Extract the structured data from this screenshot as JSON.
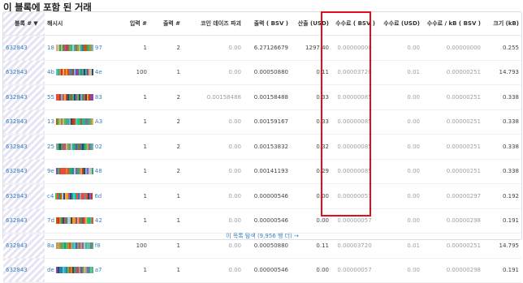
{
  "title": "이 블록에 포함 된 거래",
  "columns": {
    "block": "블록 #",
    "hash": "해시시",
    "inputs": "입력 #",
    "outputs": "출력 #",
    "coindays": "코인 데이즈 파괴",
    "output": "출력 ( BSV )",
    "output_usd": "산출 (USD)",
    "fee": "수수료 ( BSV )",
    "fee_usd": "수수료 (USD)",
    "fee_kb": "수수료 / kB ( BSV )",
    "size": "크기 (kB)"
  },
  "sort_indicator": "▼",
  "rows": [
    {
      "block": "632843",
      "hash_start": "18",
      "hash_end": "97",
      "inputs": "1",
      "outputs": "2",
      "coindays": "0.00",
      "output": "6.27126679",
      "output_usd": "1297.40",
      "fee": "0.00000000",
      "fee_usd": "0.00",
      "fee_kb": "0.00000000",
      "size": "0.255"
    },
    {
      "block": "632843",
      "hash_start": "4b",
      "hash_end": "4e",
      "inputs": "100",
      "outputs": "1",
      "coindays": "0.00",
      "output": "0.00050880",
      "output_usd": "0.11",
      "fee": "0.00003720",
      "fee_usd": "0.01",
      "fee_kb": "0.00000251",
      "size": "14.793"
    },
    {
      "block": "632843",
      "hash_start": "55",
      "hash_end": "83",
      "inputs": "1",
      "outputs": "2",
      "coindays": "0.00158488",
      "output": "0.00158488",
      "output_usd": "0.33",
      "fee": "0.00000085",
      "fee_usd": "0.00",
      "fee_kb": "0.00000251",
      "size": "0.338"
    },
    {
      "block": "632843",
      "hash_start": "13",
      "hash_end": "A3",
      "inputs": "1",
      "outputs": "2",
      "coindays": "0.00",
      "output": "0.00159167",
      "output_usd": "0.33",
      "fee": "0.00000085",
      "fee_usd": "0.00",
      "fee_kb": "0.00000251",
      "size": "0.338"
    },
    {
      "block": "632843",
      "hash_start": "25",
      "hash_end": "02",
      "inputs": "1",
      "outputs": "2",
      "coindays": "0.00",
      "output": "0.00153832",
      "output_usd": "0.32",
      "fee": "0.00000085",
      "fee_usd": "0.00",
      "fee_kb": "0.00000251",
      "size": "0.338"
    },
    {
      "block": "632843",
      "hash_start": "9e",
      "hash_end": "48",
      "inputs": "1",
      "outputs": "2",
      "coindays": "0.00",
      "output": "0.00141193",
      "output_usd": "0.29",
      "fee": "0.00000085",
      "fee_usd": "0.00",
      "fee_kb": "0.00000251",
      "size": "0.338"
    },
    {
      "block": "632843",
      "hash_start": "c4",
      "hash_end": "6d",
      "inputs": "1",
      "outputs": "1",
      "coindays": "0.00",
      "output": "0.00000546",
      "output_usd": "0.00",
      "fee": "0.00000057",
      "fee_usd": "0.00",
      "fee_kb": "0.00000297",
      "size": "0.192"
    },
    {
      "block": "632843",
      "hash_start": "7d",
      "hash_end": "42",
      "inputs": "1",
      "outputs": "1",
      "coindays": "0.00",
      "output": "0.00000546",
      "output_usd": "0.00",
      "fee": "0.00000057",
      "fee_usd": "0.00",
      "fee_kb": "0.00000298",
      "size": "0.191"
    },
    {
      "block": "632843",
      "hash_start": "8a",
      "hash_end": "f8",
      "inputs": "100",
      "outputs": "1",
      "coindays": "0.00",
      "output": "0.00050880",
      "output_usd": "0.11",
      "fee": "0.00003720",
      "fee_usd": "0.01",
      "fee_kb": "0.00000251",
      "size": "14.795"
    },
    {
      "block": "632843",
      "hash_start": "de",
      "hash_end": "a7",
      "inputs": "1",
      "outputs": "1",
      "coindays": "0.00",
      "output": "0.00000546",
      "output_usd": "0.00",
      "fee": "0.00000057",
      "fee_usd": "0.00",
      "fee_kb": "0.00000298",
      "size": "0.191"
    }
  ],
  "more_link": "이 목록 탐색 (9,956 행 더)",
  "more_arrow": "→",
  "colors": {
    "link": "#3a7fc1",
    "highlight": "#e0101a",
    "muted": "#9aa0a6"
  }
}
